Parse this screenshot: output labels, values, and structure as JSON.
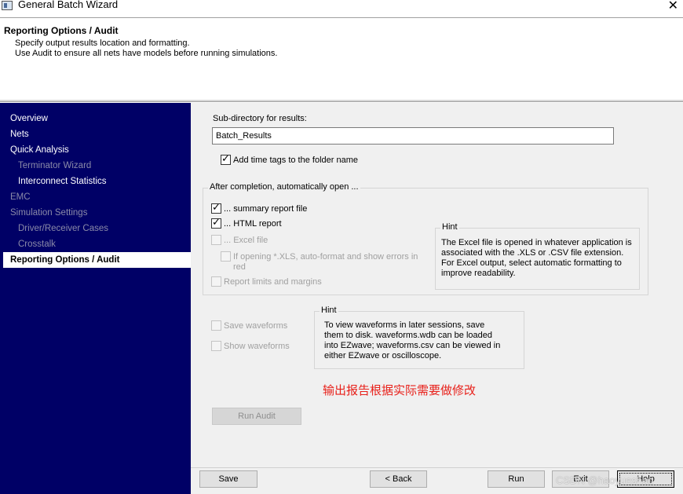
{
  "window": {
    "title": "General Batch Wizard",
    "close_symbol": "✕"
  },
  "header": {
    "title": "Reporting Options / Audit",
    "line1": "Specify output results location and formatting.",
    "line2": "Use Audit to ensure all nets have models before running simulations."
  },
  "sidebar": {
    "items": [
      {
        "label": "Overview",
        "state": "normal"
      },
      {
        "label": "Nets",
        "state": "normal"
      },
      {
        "label": "Quick Analysis",
        "state": "normal"
      },
      {
        "label": "Terminator Wizard",
        "state": "disabled"
      },
      {
        "label": "Interconnect Statistics",
        "state": "normal"
      },
      {
        "label": "EMC",
        "state": "disabled"
      },
      {
        "label": "Simulation Settings",
        "state": "disabled"
      },
      {
        "label": "Driver/Receiver Cases",
        "state": "disabled"
      },
      {
        "label": "Crosstalk",
        "state": "disabled"
      },
      {
        "label": "Reporting Options / Audit",
        "state": "selected"
      }
    ]
  },
  "main": {
    "subdir_label": "Sub-directory for results:",
    "subdir_value": "Batch_Results",
    "add_time_tags": {
      "label": "Add time tags to the folder name",
      "checked": true
    },
    "after_completion": {
      "legend": "After completion, automatically open ...",
      "summary": {
        "label": "... summary report file",
        "checked": true
      },
      "html": {
        "label": "... HTML report",
        "checked": true
      },
      "excel": {
        "label": "... Excel file",
        "checked": false,
        "enabled": false
      },
      "xls_format": {
        "label_line1": "If opening *.XLS, auto-format and show errors in",
        "label_line2": "red",
        "checked": false,
        "enabled": false
      },
      "report_limits": {
        "label": "Report limits and margins",
        "checked": false,
        "enabled": false
      },
      "hint": {
        "legend": "Hint",
        "lines": [
          "The Excel file is opened in whatever application is",
          "associated with the .XLS or .CSV file extension.",
          "For Excel output, select automatic formatting to",
          "improve readability."
        ]
      }
    },
    "save_waveforms": {
      "label": "Save waveforms",
      "checked": false,
      "enabled": false
    },
    "show_waveforms": {
      "label": "Show waveforms",
      "checked": false,
      "enabled": false
    },
    "wave_hint": {
      "legend": "Hint",
      "lines": [
        "To view waveforms in later sessions, save",
        "them to disk. waveforms.wdb can be loaded",
        "into EZwave; waveforms.csv can be viewed in",
        "either EZwave or oscilloscope."
      ]
    },
    "annotation": "输出报告根据实际需要做修改",
    "run_audit_label": "Run Audit"
  },
  "footer": {
    "save_label": "Save",
    "back_label": "< Back",
    "run_label": "Run",
    "exit_label": "Exit",
    "help_label": "Help"
  },
  "watermark": "CSDN @haoyueshao"
}
